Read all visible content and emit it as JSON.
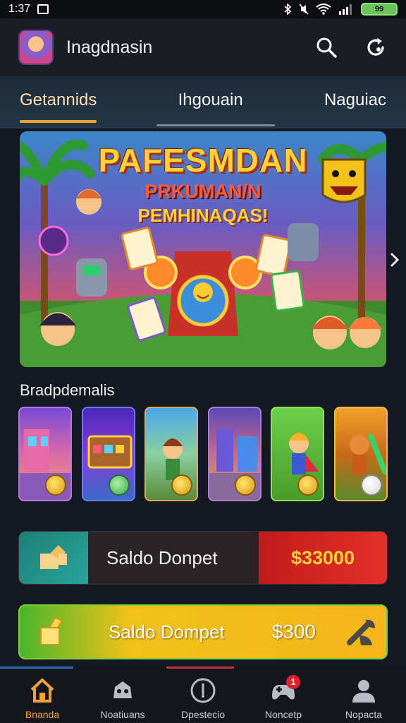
{
  "status_bar": {
    "time": "1:37",
    "battery": "99"
  },
  "app_bar": {
    "title": "Inagdnasin",
    "avatar_icon": "game-avatar-icon",
    "search_icon": "search-icon",
    "refresh_icon": "refresh-icon"
  },
  "tabs": [
    {
      "label": "Getannids",
      "active": true
    },
    {
      "label": "Ihgouain",
      "active": false
    },
    {
      "label": "Naguiac",
      "active": false
    }
  ],
  "banner": {
    "title": "PAFESMDAN",
    "subtitle_1": "PRKUMAN/N",
    "subtitle_2": "PEMHINAQAS!"
  },
  "section": {
    "title": "Bradpdemalis"
  },
  "wallets": [
    {
      "label": "Saldo Donpet",
      "amount": "$33000"
    },
    {
      "label": "Saldo Dompet",
      "amount": "$300"
    }
  ],
  "bottom_nav": [
    {
      "label": "Bnanda",
      "icon": "home-icon",
      "active": true
    },
    {
      "label": "Noatiuans",
      "icon": "controller-icon",
      "active": false
    },
    {
      "label": "Dpestecio",
      "icon": "compass-icon",
      "active": false
    },
    {
      "label": "Noncetp",
      "icon": "gamepad-icon",
      "active": false,
      "badge": "1"
    },
    {
      "label": "Nopacta",
      "icon": "profile-icon",
      "active": false
    }
  ],
  "colors": {
    "accent": "#f0a23a",
    "danger": "#d8242a",
    "wallet_green": "#49b52c",
    "wallet_gold": "#f0c21a"
  }
}
